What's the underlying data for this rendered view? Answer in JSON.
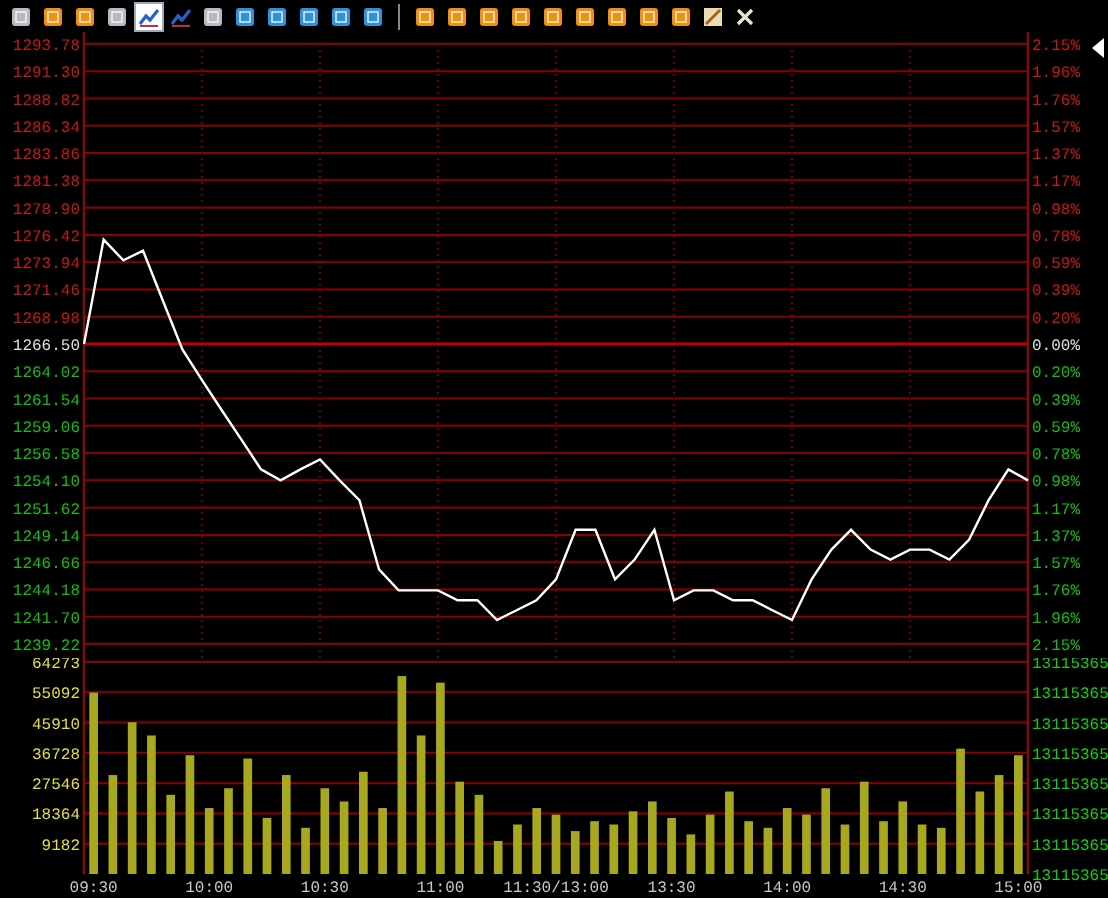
{
  "toolbar": [
    {
      "kind": "gray",
      "selected": false
    },
    {
      "kind": "orange",
      "selected": false
    },
    {
      "kind": "orange",
      "selected": false
    },
    {
      "kind": "gray",
      "selected": false
    },
    {
      "kind": "chart",
      "selected": true
    },
    {
      "kind": "chart",
      "selected": false
    },
    {
      "kind": "gray",
      "selected": false
    },
    {
      "kind": "blue",
      "selected": false
    },
    {
      "kind": "blue",
      "selected": false
    },
    {
      "kind": "blue",
      "selected": false
    },
    {
      "kind": "blue",
      "selected": false
    },
    {
      "kind": "blue",
      "selected": false
    },
    {
      "kind": "separator"
    },
    {
      "kind": "orange",
      "selected": false
    },
    {
      "kind": "orange",
      "selected": false
    },
    {
      "kind": "orange",
      "selected": false
    },
    {
      "kind": "orange",
      "selected": false
    },
    {
      "kind": "orange",
      "selected": false
    },
    {
      "kind": "orange",
      "selected": false
    },
    {
      "kind": "orange",
      "selected": false
    },
    {
      "kind": "orange",
      "selected": false
    },
    {
      "kind": "orange",
      "selected": false
    },
    {
      "kind": "pen",
      "selected": false
    },
    {
      "kind": "close",
      "selected": false
    }
  ],
  "price_panel": {
    "percent_labels": [
      "2.15%",
      "1.96%",
      "1.76%",
      "1.57%",
      "1.37%",
      "1.17%",
      "0.98%",
      "0.78%",
      "0.59%",
      "0.39%",
      "0.20%",
      "0.00%",
      "0.20%",
      "0.39%",
      "0.59%",
      "0.78%",
      "0.98%",
      "1.17%",
      "1.37%",
      "1.57%",
      "1.76%",
      "1.96%",
      "2.15%"
    ],
    "chart_data": {
      "type": "line",
      "grid": true,
      "ref_lines": [
        {
          "axis": "y",
          "value": 1266.5
        }
      ],
      "ylim": [
        1239.22,
        1293.78
      ],
      "categories": [
        null,
        null,
        null,
        null,
        null,
        null,
        null,
        null,
        null,
        null,
        null,
        null,
        null,
        null,
        null,
        null,
        null,
        null,
        null,
        null,
        null,
        null,
        null,
        null,
        null,
        null,
        null,
        null,
        null,
        null,
        null,
        null,
        null,
        null,
        null,
        null,
        null,
        null,
        null,
        null,
        null,
        null,
        null,
        null,
        null,
        null,
        null,
        null,
        null
      ],
      "yticks": [
        {
          "value": 1293.78,
          "label": "1293.78"
        },
        {
          "value": 1291.3,
          "label": "1291.30"
        },
        {
          "value": 1288.82,
          "label": "1288.82"
        },
        {
          "value": 1286.34,
          "label": "1286.34"
        },
        {
          "value": 1283.86,
          "label": "1283.86"
        },
        {
          "value": 1281.38,
          "label": "1281.38"
        },
        {
          "value": 1278.9,
          "label": "1278.90"
        },
        {
          "value": 1276.42,
          "label": "1276.42"
        },
        {
          "value": 1273.94,
          "label": "1273.94"
        },
        {
          "value": 1271.46,
          "label": "1271.46"
        },
        {
          "value": 1268.98,
          "label": "1268.98"
        },
        {
          "value": 1266.5,
          "label": "1266.50"
        },
        {
          "value": 1264.02,
          "label": "1264.02"
        },
        {
          "value": 1261.54,
          "label": "1261.54"
        },
        {
          "value": 1259.06,
          "label": "1259.06"
        },
        {
          "value": 1256.58,
          "label": "1256.58"
        },
        {
          "value": 1254.1,
          "label": "1254.10"
        },
        {
          "value": 1251.62,
          "label": "1251.62"
        },
        {
          "value": 1249.14,
          "label": "1249.14"
        },
        {
          "value": 1246.66,
          "label": "1246.66"
        },
        {
          "value": 1244.18,
          "label": "1244.18"
        },
        {
          "value": 1241.7,
          "label": "1241.70"
        },
        {
          "value": 1239.22,
          "label": "1239.22"
        }
      ],
      "series": [
        {
          "color": "#ffffff",
          "values": [
            1266.5,
            1276.0,
            1274.1,
            1275.0,
            1270.5,
            1266.0,
            1263.2,
            1260.5,
            1257.8,
            1255.1,
            1254.1,
            1255.1,
            1256.0,
            1254.1,
            1252.3,
            1246.0,
            1244.1,
            1244.1,
            1244.1,
            1243.2,
            1243.2,
            1241.4,
            1242.3,
            1243.2,
            1245.1,
            1249.6,
            1249.6,
            1245.1,
            1246.9,
            1249.6,
            1243.2,
            1244.1,
            1244.1,
            1243.2,
            1243.2,
            1242.3,
            1241.4,
            1245.1,
            1247.8,
            1249.6,
            1247.8,
            1246.9,
            1247.8,
            1247.8,
            1246.9,
            1248.7,
            1252.3,
            1255.1,
            1254.1
          ]
        }
      ]
    }
  },
  "volume_panel": {
    "right_labels": [
      "13115365",
      "13115365",
      "13115365",
      "13115365",
      "13115365",
      "13115365",
      "13115365",
      "13115365"
    ],
    "chart_data": {
      "type": "bar",
      "grid": true,
      "ylim": [
        0,
        64273
      ],
      "yticks": [
        64273,
        55092,
        45910,
        36728,
        27546,
        18364,
        9182
      ],
      "categories": [
        "09:30",
        null,
        null,
        null,
        null,
        null,
        "10:00",
        null,
        null,
        null,
        null,
        null,
        "10:30",
        null,
        null,
        null,
        null,
        null,
        "11:00",
        null,
        null,
        null,
        null,
        null,
        "11:30/13:00",
        null,
        null,
        null,
        null,
        null,
        "13:30",
        null,
        null,
        null,
        null,
        null,
        "14:00",
        null,
        null,
        null,
        null,
        null,
        "14:30",
        null,
        null,
        null,
        null,
        null,
        "15:00"
      ],
      "series": [
        {
          "color": "#a8a820",
          "values": [
            55000,
            30000,
            46000,
            42000,
            24000,
            36000,
            20000,
            26000,
            35000,
            17000,
            30000,
            14000,
            26000,
            22000,
            31000,
            20000,
            60000,
            42000,
            58000,
            28000,
            24000,
            10000,
            15000,
            20000,
            18000,
            13000,
            16000,
            15000,
            19000,
            22000,
            17000,
            12000,
            18000,
            25000,
            16000,
            14000,
            20000,
            18000,
            26000,
            15000,
            28000,
            16000,
            22000,
            15000,
            14000,
            38000,
            25000,
            30000,
            36000
          ]
        }
      ]
    }
  }
}
